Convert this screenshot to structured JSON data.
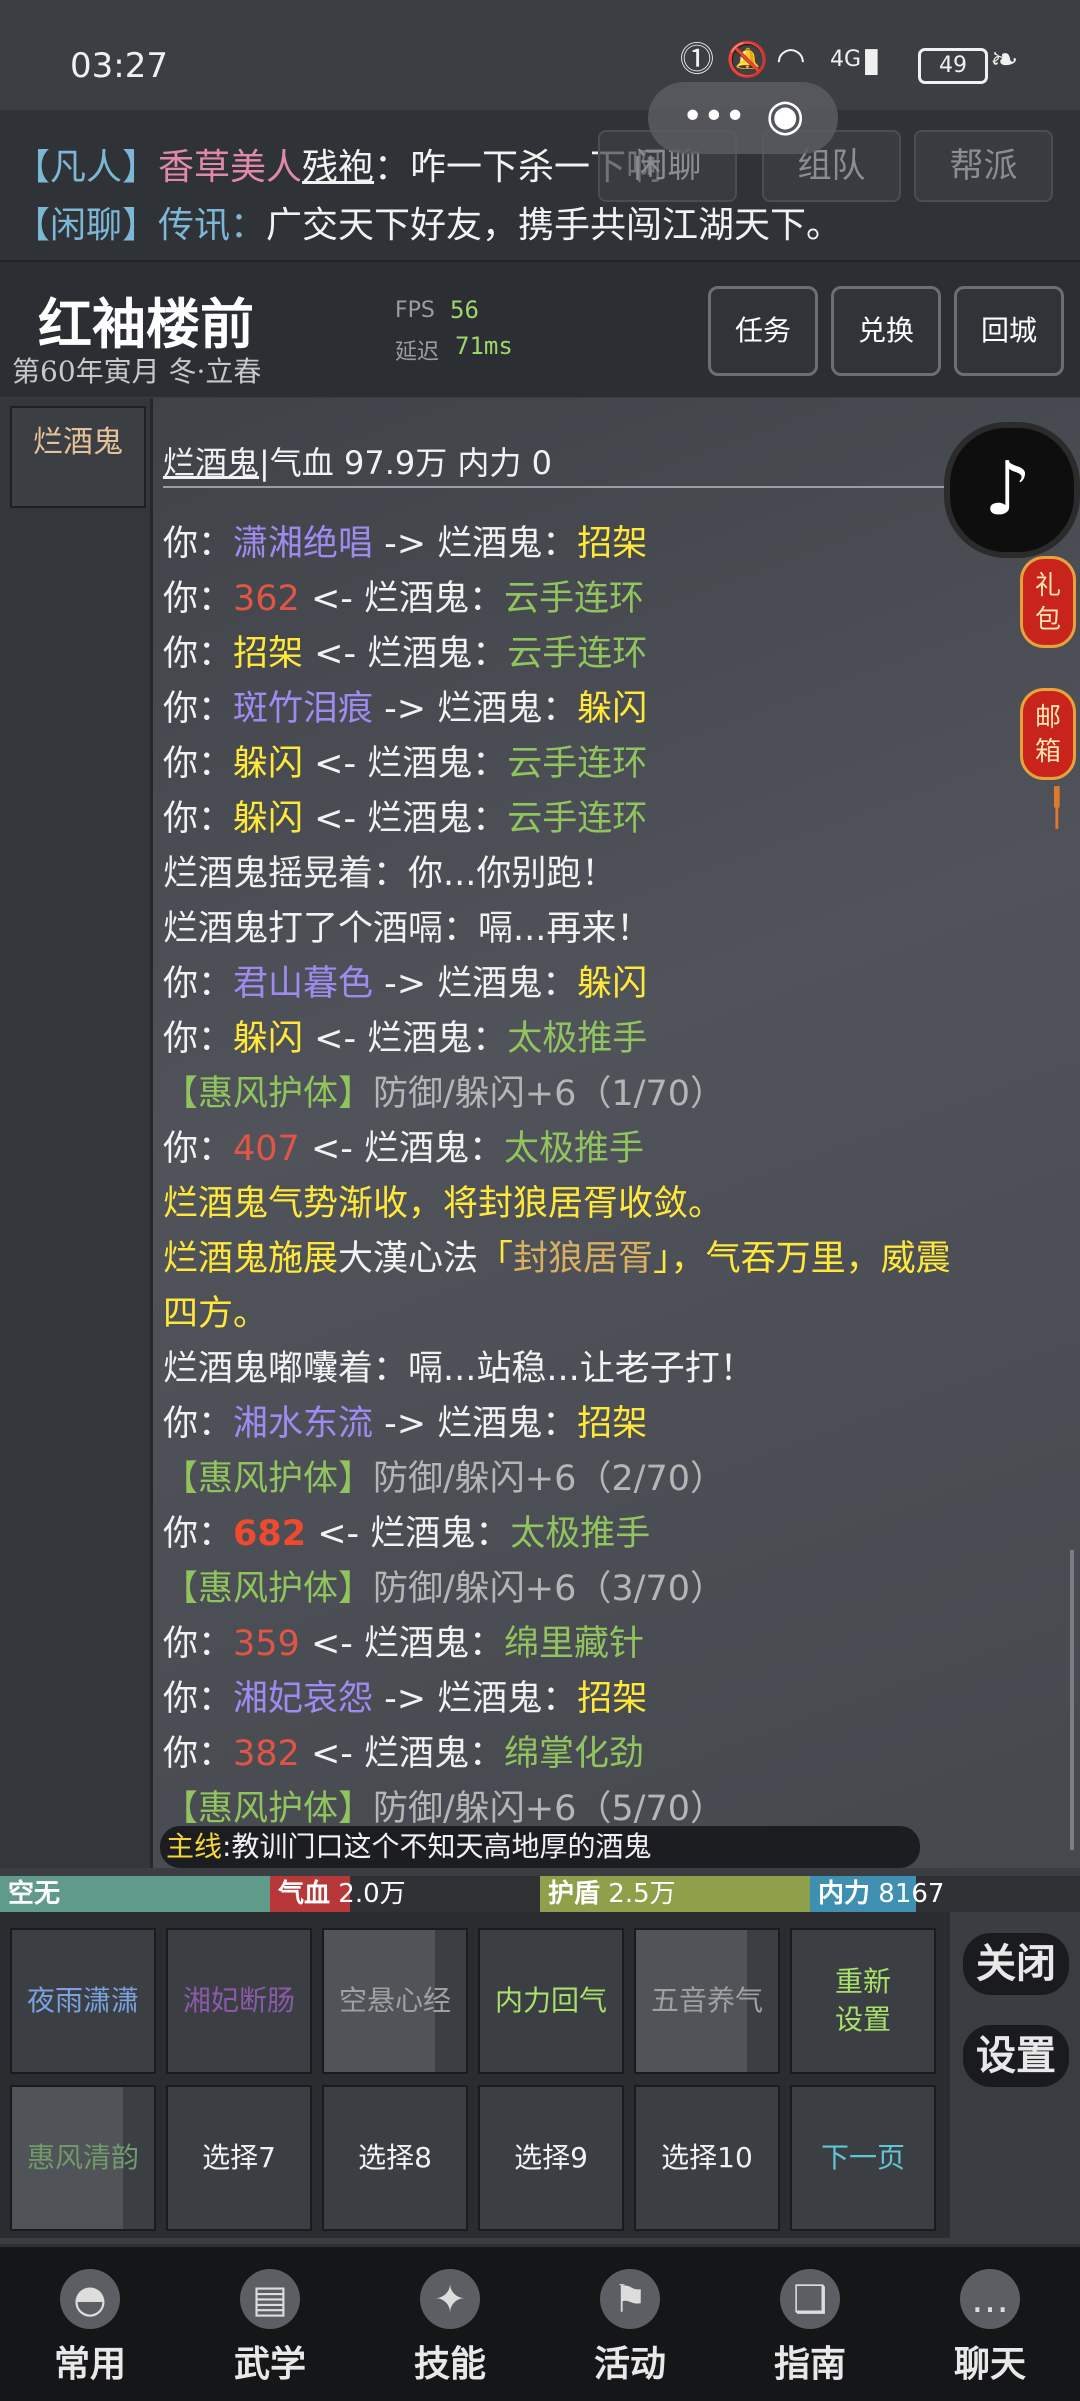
{
  "status_bar": {
    "time": "03:27",
    "battery": "49",
    "network": "4G"
  },
  "chat": {
    "lines": [
      {
        "channel": "【凡人】",
        "speaker": "香草美人",
        "target": "残袍",
        "text": "：咋一下杀一下啊"
      },
      {
        "channel": "【闲聊】",
        "speaker": "传讯：",
        "text": "广交天下好友，携手共闯江湖天下。"
      }
    ],
    "tabs": [
      "闲聊",
      "组队",
      "帮派"
    ]
  },
  "header": {
    "location": "红袖楼前",
    "date": "第60年寅月 冬·立春",
    "fps_label": "FPS",
    "fps_value": "56",
    "latency_label": "延迟",
    "latency_value": "71ms",
    "buttons": [
      "任务",
      "兑换",
      "回城"
    ]
  },
  "battle": {
    "target_tab": "烂酒鬼",
    "target_name": "烂酒鬼",
    "target_stats": "|气血 97.9万  内力 0",
    "log": [
      [
        [
          "你：",
          "white"
        ],
        [
          "潇湘绝唱",
          "purple"
        ],
        [
          " -> 烂酒鬼：",
          "white"
        ],
        [
          "招架",
          "yellow"
        ]
      ],
      [
        [
          "你：",
          "white"
        ],
        [
          "362",
          "red"
        ],
        [
          " <- 烂酒鬼：",
          "white"
        ],
        [
          "云手连环",
          "green"
        ]
      ],
      [
        [
          "你：",
          "white"
        ],
        [
          "招架",
          "yellow"
        ],
        [
          " <- 烂酒鬼：",
          "white"
        ],
        [
          "云手连环",
          "green"
        ]
      ],
      [
        [
          "你：",
          "white"
        ],
        [
          "斑竹泪痕",
          "purple"
        ],
        [
          " -> 烂酒鬼：",
          "white"
        ],
        [
          "躲闪",
          "yellow"
        ]
      ],
      [
        [
          "你：",
          "white"
        ],
        [
          "躲闪",
          "yellow"
        ],
        [
          " <- 烂酒鬼：",
          "white"
        ],
        [
          "云手连环",
          "green"
        ]
      ],
      [
        [
          "你：",
          "white"
        ],
        [
          "躲闪",
          "yellow"
        ],
        [
          " <- 烂酒鬼：",
          "white"
        ],
        [
          "云手连环",
          "green"
        ]
      ],
      [
        [
          "烂酒鬼摇晃着：你...你别跑！",
          "white"
        ]
      ],
      [
        [
          "烂酒鬼打了个酒嗝：嗝...再来！",
          "white"
        ]
      ],
      [
        [
          "你：",
          "white"
        ],
        [
          "君山暮色",
          "purple"
        ],
        [
          " -> 烂酒鬼：",
          "white"
        ],
        [
          "躲闪",
          "yellow"
        ]
      ],
      [
        [
          "你：",
          "white"
        ],
        [
          "躲闪",
          "yellow"
        ],
        [
          " <- 烂酒鬼：",
          "white"
        ],
        [
          "太极推手",
          "green"
        ]
      ],
      [
        [
          "【惠风护体】",
          "buff"
        ],
        [
          "防御/躲闪+6（1/70）",
          "gray"
        ]
      ],
      [
        [
          "你：",
          "white"
        ],
        [
          "407",
          "red"
        ],
        [
          " <- 烂酒鬼：",
          "white"
        ],
        [
          "太极推手",
          "green"
        ]
      ],
      [
        [
          "烂酒鬼气势渐收，将封狼居胥收敛。",
          "yellow"
        ]
      ],
      [
        [
          "烂酒鬼施展",
          "yellow"
        ],
        [
          "大漢心法",
          "white"
        ],
        [
          "「",
          "yellow"
        ],
        [
          "封狼居胥",
          "gold"
        ],
        [
          "」，气吞万里，威震",
          "yellow"
        ]
      ],
      [
        [
          "四方。",
          "yellow"
        ]
      ],
      [
        [
          "烂酒鬼嘟囔着：嗝...站稳...让老子打！",
          "white"
        ]
      ],
      [
        [
          "你：",
          "white"
        ],
        [
          "湘水东流",
          "purple"
        ],
        [
          " -> 烂酒鬼：",
          "white"
        ],
        [
          "招架",
          "yellow"
        ]
      ],
      [
        [
          "【惠风护体】",
          "buff"
        ],
        [
          "防御/躲闪+6（2/70）",
          "gray"
        ]
      ],
      [
        [
          "你：",
          "white"
        ],
        [
          "682",
          "red-b"
        ],
        [
          " <- 烂酒鬼：",
          "white"
        ],
        [
          "太极推手",
          "green"
        ]
      ],
      [
        [
          "【惠风护体】",
          "buff"
        ],
        [
          "防御/躲闪+6（3/70）",
          "gray"
        ]
      ],
      [
        [
          "你：",
          "white"
        ],
        [
          "359",
          "red"
        ],
        [
          " <- 烂酒鬼：",
          "white"
        ],
        [
          "绵里藏针",
          "green"
        ]
      ],
      [
        [
          "你：",
          "white"
        ],
        [
          "湘妃哀怨",
          "purple"
        ],
        [
          " -> 烂酒鬼：",
          "white"
        ],
        [
          "招架",
          "yellow"
        ]
      ],
      [
        [
          "你：",
          "white"
        ],
        [
          "382",
          "red"
        ],
        [
          " <- 烂酒鬼：",
          "white"
        ],
        [
          "绵掌化劲",
          "green"
        ]
      ],
      [
        [
          "【惠风护体】",
          "buff"
        ],
        [
          "防御/躲闪+6（5/70）",
          "gray"
        ]
      ]
    ]
  },
  "side": {
    "gift": "礼包",
    "mail": "邮箱"
  },
  "quest": {
    "label": "主线",
    "text": ":教训门口这个不知天高地厚的酒鬼"
  },
  "bars": {
    "stance": "空无",
    "hp_label": "气血",
    "hp_value": "2.0万",
    "shield_label": "护盾",
    "shield_value": "2.5万",
    "mp_label": "内力",
    "mp_value": "8167",
    "colors": {
      "stance": "#5f9a8a",
      "hp": "#b8383a",
      "shield": "#8ea04a",
      "mp": "#3f8fb0"
    }
  },
  "skills": [
    {
      "label": "夜雨潇潇",
      "color": "#7aa2e0",
      "cd": false
    },
    {
      "label": "湘妃断肠",
      "color": "#8a5aa8",
      "cd": false
    },
    {
      "label": "空悬心经",
      "color": "#a0a0a0",
      "cd": true
    },
    {
      "label": "内力回气",
      "color": "#a8e06a",
      "cd": false
    },
    {
      "label": "五音养气",
      "color": "#a0a0a0",
      "cd": true
    },
    {
      "label": "重新\n设置",
      "color": "#a8e06a",
      "cd": false
    },
    {
      "label": "惠风清韵",
      "color": "#6f9a6a",
      "cd": true
    },
    {
      "label": "选择7",
      "color": "#f2f2f2",
      "cd": false
    },
    {
      "label": "选择8",
      "color": "#f2f2f2",
      "cd": false
    },
    {
      "label": "选择9",
      "color": "#f2f2f2",
      "cd": false
    },
    {
      "label": "选择10",
      "color": "#f2f2f2",
      "cd": false
    },
    {
      "label": "下一页",
      "color": "#5fc6d8",
      "cd": false
    }
  ],
  "side_buttons": [
    "关闭",
    "设置"
  ],
  "nav": [
    {
      "label": "常用",
      "icon": "straw-hat-icon"
    },
    {
      "label": "武学",
      "icon": "scroll-icon"
    },
    {
      "label": "技能",
      "icon": "martial-pose-icon"
    },
    {
      "label": "活动",
      "icon": "banner-icon"
    },
    {
      "label": "指南",
      "icon": "book-icon"
    },
    {
      "label": "聊天",
      "icon": "chat-bubble-icon"
    }
  ]
}
